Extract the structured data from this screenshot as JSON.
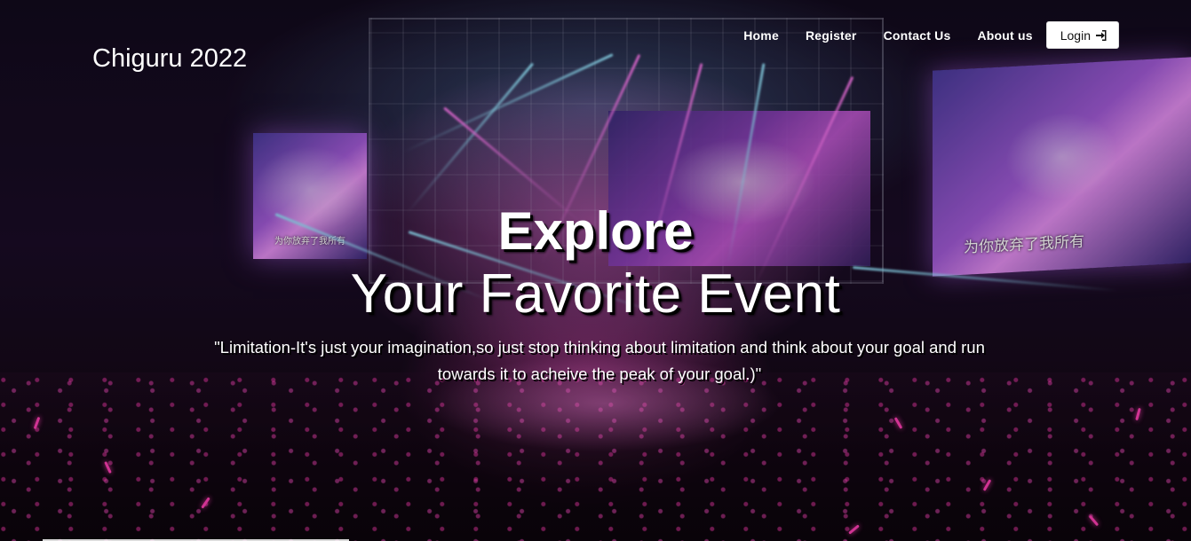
{
  "header": {
    "brand": "Chiguru 2022",
    "nav": [
      {
        "label": "Home"
      },
      {
        "label": "Register"
      },
      {
        "label": "Contact Us"
      },
      {
        "label": "About us"
      }
    ],
    "login_label": "Login",
    "login_icon": "sign-in-icon"
  },
  "hero": {
    "title_line1": "Explore",
    "title_line2": "Your Favorite Event",
    "quote_line1": "\"Limitation-It's just your imagination,so just stop thinking about limitation and think about your goal and run",
    "quote_line2": "towards it to acheive the peak of your goal.)\"",
    "screen_caption": "为你放弃了我所有"
  },
  "colors": {
    "accent_pink": "#ff3fb4",
    "login_bg": "#ffffff",
    "text": "#ffffff"
  }
}
